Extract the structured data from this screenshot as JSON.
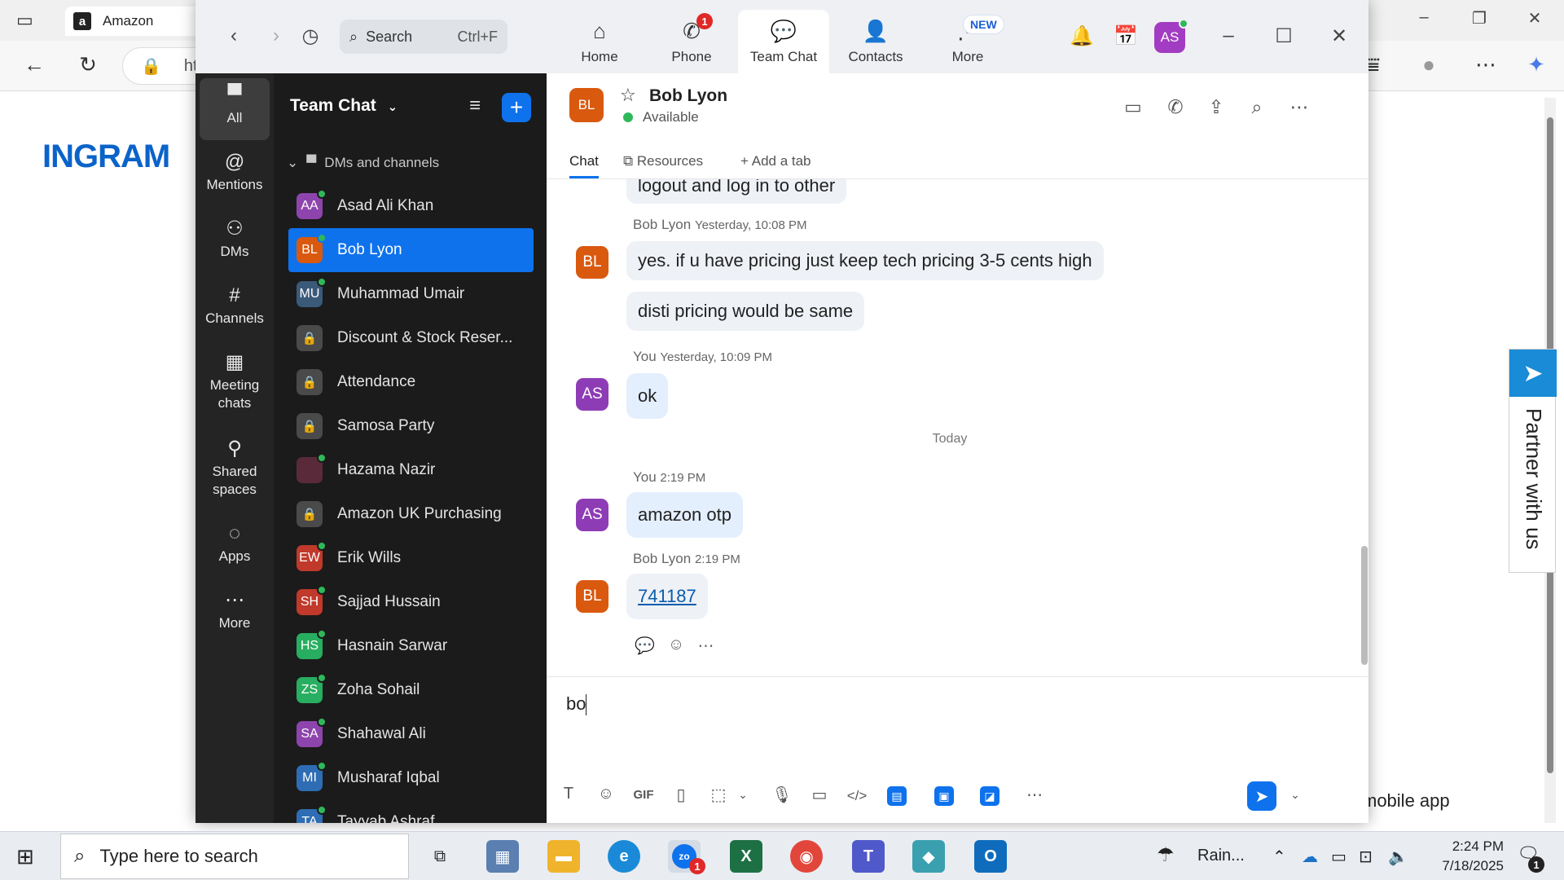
{
  "browser": {
    "tab_title": "Amazon",
    "tab_favicon": "a",
    "address_partial": "ht",
    "window_controls": [
      "–",
      "❐",
      "✕"
    ],
    "logo_text": "INGRAM",
    "partner_tab": "Partner with us",
    "mobile_app_text": "mobile app"
  },
  "zoom": {
    "search": {
      "placeholder": "Search",
      "shortcut": "Ctrl+F"
    },
    "tabs": [
      {
        "label": "Home",
        "icon": "home-icon"
      },
      {
        "label": "Phone",
        "icon": "phone-icon",
        "badge": "1"
      },
      {
        "label": "Team Chat",
        "icon": "chat-icon",
        "active": true
      },
      {
        "label": "Contacts",
        "icon": "contacts-icon"
      },
      {
        "label": "More",
        "icon": "more-icon",
        "tag": "NEW"
      }
    ],
    "user_initials": "AS",
    "rail": [
      {
        "label": "All",
        "icon": "chat-bubble-icon",
        "active": true
      },
      {
        "label": "Mentions",
        "icon": "at-icon"
      },
      {
        "label": "DMs",
        "icon": "people-icon"
      },
      {
        "label": "Channels",
        "icon": "hash-icon"
      },
      {
        "label": "Meeting chats",
        "icon": "calendar-icon"
      },
      {
        "label": "Shared spaces",
        "icon": "share-nodes-icon"
      },
      {
        "label": "Apps",
        "icon": "apps-icon"
      },
      {
        "label": "More",
        "icon": "ellipsis-icon"
      }
    ],
    "list": {
      "title": "Team Chat",
      "section": "DMs and channels",
      "items": [
        {
          "initials": "AA",
          "name": "Asad Ali Khan",
          "color": "#8e44ad",
          "online": true
        },
        {
          "initials": "BL",
          "name": "Bob Lyon",
          "color": "#d9590f",
          "online": true,
          "active": true
        },
        {
          "initials": "MU",
          "name": "Muhammad Umair",
          "color": "#3b5a7a",
          "online": true
        },
        {
          "initials": "",
          "name": "Discount & Stock Reser...",
          "color": "#4a4a4a",
          "lock": true
        },
        {
          "initials": "",
          "name": "Attendance",
          "color": "#4a4a4a",
          "lock": true
        },
        {
          "initials": "",
          "name": "Samosa Party",
          "color": "#4a4a4a",
          "lock": true
        },
        {
          "initials": "",
          "name": "Hazama Nazir",
          "color": "#5a2a3a",
          "online": true
        },
        {
          "initials": "",
          "name": "Amazon UK Purchasing",
          "color": "#4a4a4a",
          "lock": true
        },
        {
          "initials": "EW",
          "name": "Erik Wills",
          "color": "#c0392b",
          "online": true
        },
        {
          "initials": "SH",
          "name": "Sajjad Hussain",
          "color": "#c0392b",
          "online": true
        },
        {
          "initials": "HS",
          "name": "Hasnain Sarwar",
          "color": "#27ae60",
          "online": true
        },
        {
          "initials": "ZS",
          "name": "Zoha Sohail",
          "color": "#27ae60",
          "online": true
        },
        {
          "initials": "SA",
          "name": "Shahawal Ali",
          "color": "#8e44ad",
          "online": true
        },
        {
          "initials": "MI",
          "name": "Musharaf Iqbal",
          "color": "#2e6db4",
          "online": true
        },
        {
          "initials": "TA",
          "name": "Tayyab Ashraf",
          "color": "#2e6db4",
          "online": true
        }
      ]
    },
    "chat": {
      "contact": {
        "initials": "BL",
        "name": "Bob Lyon",
        "status": "Available"
      },
      "tabs": [
        "Chat",
        "Resources",
        "Add a tab"
      ],
      "messages": [
        {
          "sender": "",
          "time": "",
          "text": "logout and log in to other"
        },
        {
          "sender": "Bob Lyon",
          "time": "Yesterday, 10:08 PM",
          "initials": "BL",
          "text": "yes. if u have pricing just keep tech pricing 3-5 cents high"
        },
        {
          "sender": "",
          "time": "",
          "text": "disti pricing would be same"
        },
        {
          "sender": "You",
          "time": "Yesterday, 10:09 PM",
          "initials": "AS",
          "text": "ok"
        },
        {
          "divider": "Today"
        },
        {
          "sender": "You",
          "time": "2:19 PM",
          "initials": "AS",
          "text": "amazon otp"
        },
        {
          "sender": "Bob Lyon",
          "time": "2:19 PM",
          "initials": "BL",
          "text": "741187"
        }
      ],
      "compose_text": "bo"
    }
  },
  "taskbar": {
    "search_placeholder": "Type here to search",
    "weather": "Rain...",
    "time": "2:24 PM",
    "date": "7/18/2025",
    "notifications": "1",
    "zoom_badge": "1"
  },
  "colors": {
    "accent": "#0e72ed",
    "online": "#2fb85b",
    "sidebar": "#1b1b1b"
  }
}
